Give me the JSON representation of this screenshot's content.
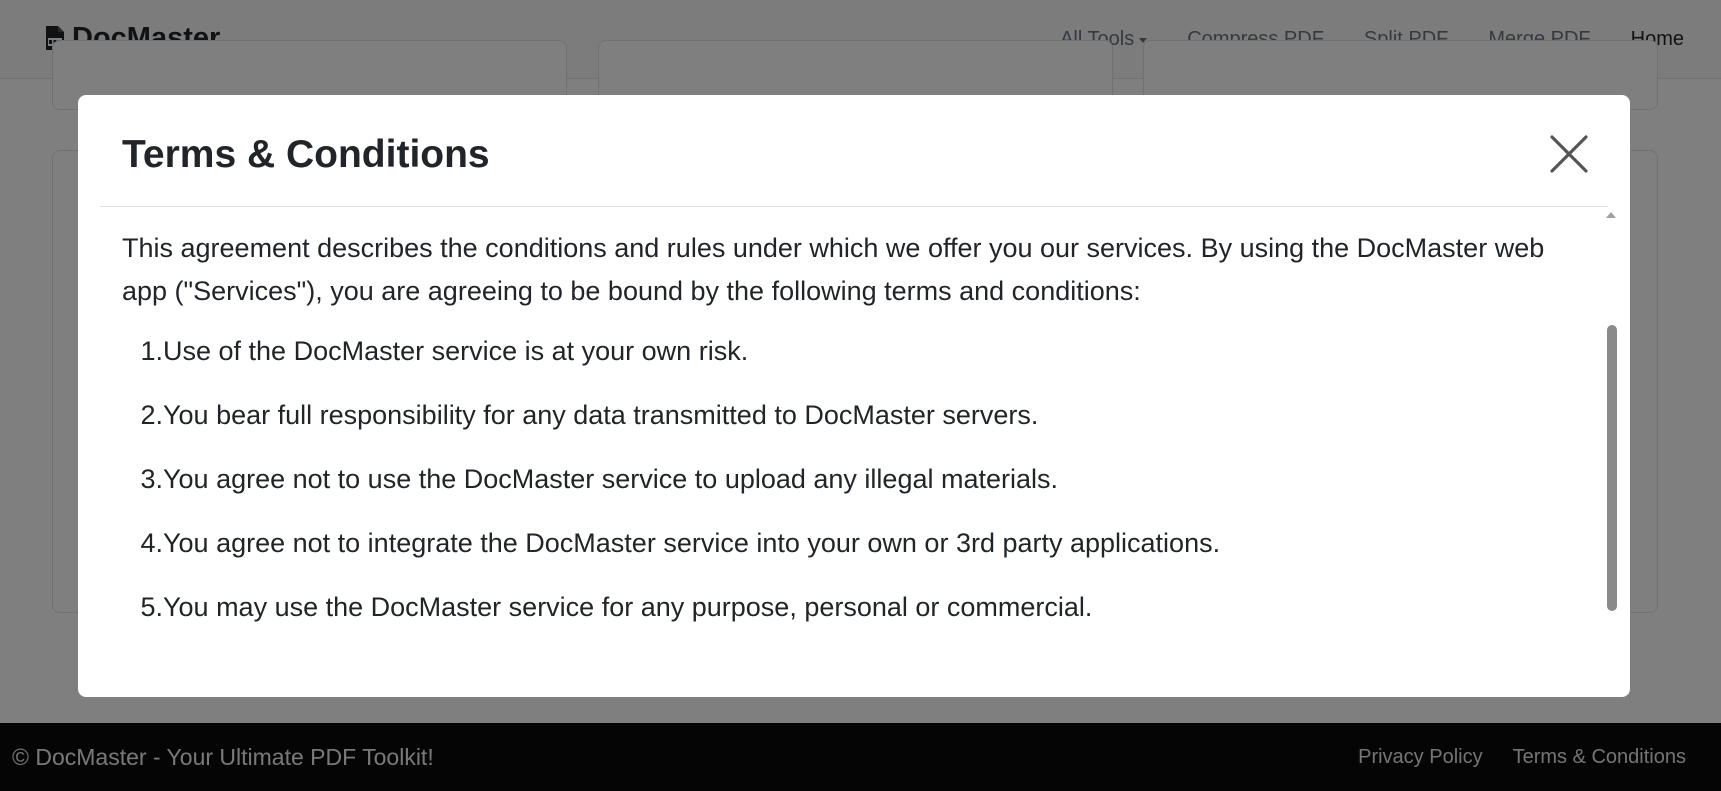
{
  "navbar": {
    "brand": "DocMaster",
    "brand_icon": "pdf-document-icon",
    "links": [
      {
        "label": "All Tools",
        "dropdown": true
      },
      {
        "label": "Compress PDF"
      },
      {
        "label": "Split PDF"
      },
      {
        "label": "Merge PDF"
      },
      {
        "label": "Home",
        "active": true
      }
    ]
  },
  "modal": {
    "title": "Terms & Conditions",
    "close_icon": "close-icon",
    "intro": "This agreement describes the conditions and rules under which we offer you our services. By using the DocMaster web app (\"Services\"), you are agreeing to be bound by the following terms and conditions:",
    "items": [
      {
        "num": "1.",
        "text": "Use of the DocMaster service is at your own risk."
      },
      {
        "num": "2.",
        "text": "You bear full responsibility for any data transmitted to DocMaster servers."
      },
      {
        "num": "3.",
        "text": "You agree not to use the DocMaster service to upload any illegal materials."
      },
      {
        "num": "4.",
        "text": "You agree not to integrate the DocMaster service into your own or 3rd party applications."
      },
      {
        "num": "5.",
        "text": "You may use the DocMaster service for any purpose, personal or commercial."
      }
    ]
  },
  "footer": {
    "copyright": "© DocMaster - Your Ultimate PDF Toolkit!",
    "links": [
      {
        "label": "Privacy Policy"
      },
      {
        "label": "Terms & Conditions"
      }
    ]
  },
  "colors": {
    "backdrop": "#000000",
    "footer_bg": "#0b0b0b",
    "navbar_bg": "#f8f9fa"
  }
}
